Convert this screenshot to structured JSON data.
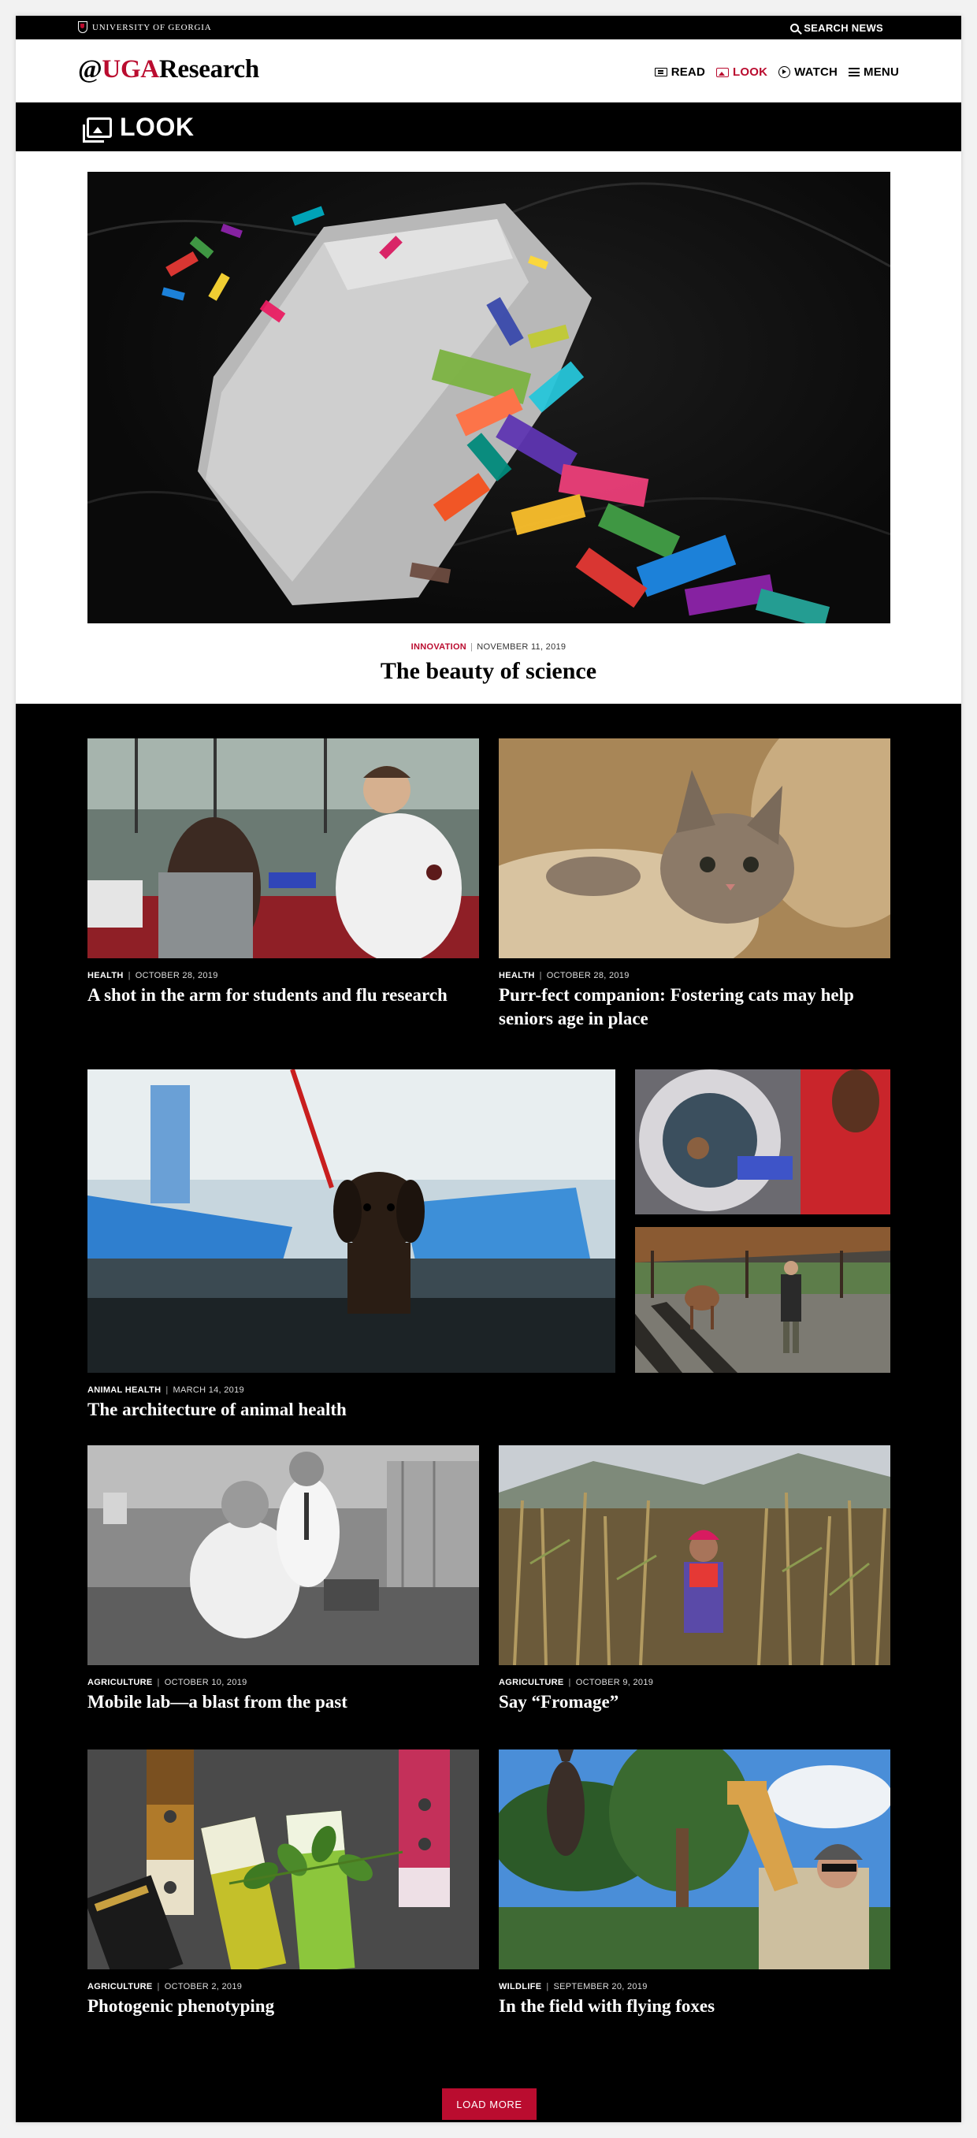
{
  "topbar": {
    "university": "University of Georgia",
    "search_label": "Search News"
  },
  "header": {
    "logo_at": "@",
    "logo_uga": "UGA",
    "logo_research": "Research",
    "nav": [
      {
        "label": "READ",
        "icon": "newspaper-icon",
        "active": false
      },
      {
        "label": "LOOK",
        "icon": "image-icon",
        "active": true
      },
      {
        "label": "WATCH",
        "icon": "play-icon",
        "active": false
      },
      {
        "label": "MENU",
        "icon": "hamburger-icon",
        "active": false
      }
    ]
  },
  "section": {
    "title": "LOOK",
    "icon": "image-stack-icon"
  },
  "hero": {
    "category": "INNOVATION",
    "date": "NOVEMBER 11, 2019",
    "title": "The beauty of science"
  },
  "cards": [
    {
      "category": "HEALTH",
      "date": "OCTOBER 28, 2019",
      "title": "A shot in the arm for students and flu research"
    },
    {
      "category": "HEALTH",
      "date": "OCTOBER 28, 2019",
      "title": "Purr-fect companion: Fostering cats may help seniors age in place"
    },
    {
      "category": "ANIMAL HEALTH",
      "date": "MARCH 14, 2019",
      "title": "The architecture of animal health"
    },
    {
      "category": "AGRICULTURE",
      "date": "OCTOBER 10, 2019",
      "title": "Mobile lab—a blast from the past"
    },
    {
      "category": "AGRICULTURE",
      "date": "OCTOBER 9, 2019",
      "title": "Say “Fromage”"
    },
    {
      "category": "AGRICULTURE",
      "date": "OCTOBER 2, 2019",
      "title": "Photogenic phenotyping"
    },
    {
      "category": "WILDLIFE",
      "date": "SEPTEMBER 20, 2019",
      "title": "In the field with flying foxes"
    }
  ],
  "load_more": "LOAD MORE",
  "colors": {
    "accent": "#ba0c2f",
    "dark": "#000000",
    "page_bg": "#f2f2f2"
  }
}
